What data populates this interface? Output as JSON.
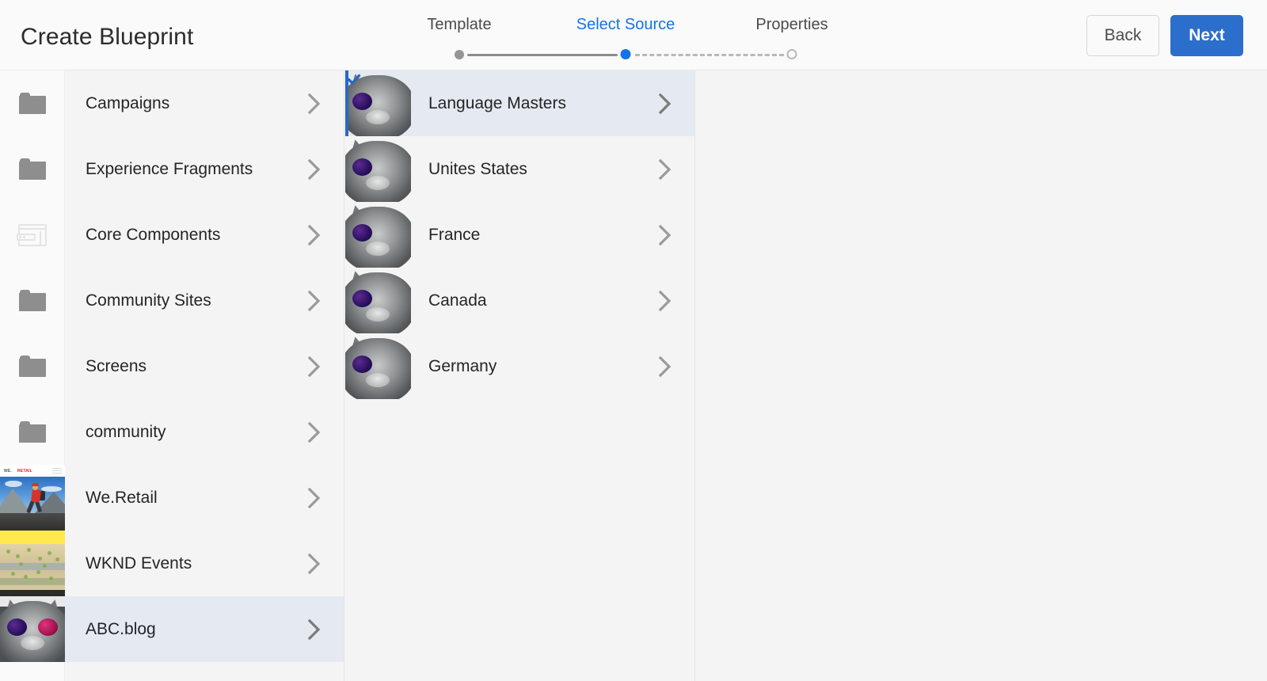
{
  "header": {
    "title": "Create Blueprint",
    "back_label": "Back",
    "next_label": "Next"
  },
  "stepper": {
    "steps": [
      {
        "label": "Template",
        "state": "done"
      },
      {
        "label": "Select Source",
        "state": "current"
      },
      {
        "label": "Properties",
        "state": "pending"
      }
    ],
    "active_color": "#1473e6",
    "done_color": "#959595",
    "pending_color": "#b9b9b9"
  },
  "columns": [
    {
      "name": "source-column",
      "items": [
        {
          "label": "Campaigns",
          "icon": "folder-icon",
          "selected": false
        },
        {
          "label": "Experience Fragments",
          "icon": "folder-icon",
          "selected": false
        },
        {
          "label": "Core Components",
          "icon": "card-icon",
          "selected": false
        },
        {
          "label": "Community Sites",
          "icon": "folder-icon",
          "selected": false
        },
        {
          "label": "Screens",
          "icon": "folder-icon",
          "selected": false
        },
        {
          "label": "community",
          "icon": "folder-icon",
          "selected": false
        },
        {
          "label": "We.Retail",
          "icon": "retail-thumbnail-icon",
          "selected": false
        },
        {
          "label": "WKND Events",
          "icon": "wknd-thumbnail-icon",
          "selected": false
        },
        {
          "label": "ABC.blog",
          "icon": "cat-thumbnail-icon",
          "selected": true
        }
      ]
    },
    {
      "name": "language-column",
      "items": [
        {
          "label": "Language Masters",
          "icon": "cat-thumbnail-icon",
          "selected": true,
          "checked": true
        },
        {
          "label": "Unites States",
          "icon": "cat-thumbnail-icon",
          "selected": false,
          "checked": false
        },
        {
          "label": "France",
          "icon": "cat-thumbnail-icon",
          "selected": false,
          "checked": false
        },
        {
          "label": "Canada",
          "icon": "cat-thumbnail-icon",
          "selected": false,
          "checked": false
        },
        {
          "label": "Germany",
          "icon": "cat-thumbnail-icon",
          "selected": false,
          "checked": false
        }
      ]
    },
    {
      "name": "detail-column",
      "items": []
    }
  ],
  "thumbnail_text": {
    "retail_brand_1": "WE.",
    "retail_brand_2": "RETAIL"
  },
  "colors": {
    "selection_blue": "#2a68c4",
    "selection_row_bg": "#e4e9f2",
    "page_bg": "#f4f4f4",
    "header_bg": "#fafafa",
    "next_button": "#2c6ecb"
  }
}
